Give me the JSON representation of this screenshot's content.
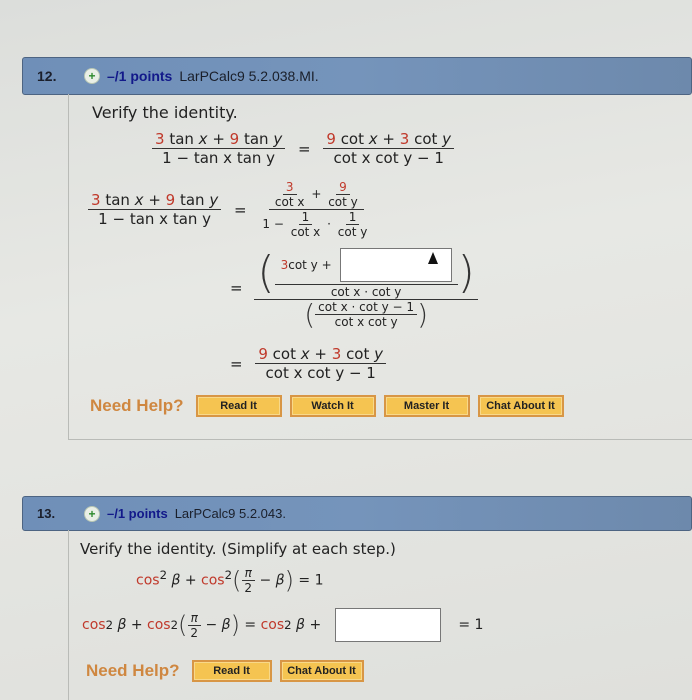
{
  "questions": [
    {
      "number": "12.",
      "points": "–/1 points",
      "code": "LarPCalc9 5.2.038.MI.",
      "prompt": "Verify the identity.",
      "identity": {
        "lhs_num": [
          "3",
          " tan ",
          "x",
          " + ",
          "9",
          " tan ",
          "y"
        ],
        "lhs_den": "1 − tan x tan y",
        "rhs_num": [
          "9",
          " cot ",
          "x",
          " + ",
          "3",
          " cot ",
          "y"
        ],
        "rhs_den": "cot x cot y − 1"
      },
      "step1": {
        "a_num": "3",
        "a_den": "cot x",
        "b_num": "9",
        "b_den": "cot y",
        "den_prefix": "1 −",
        "c_num": "1",
        "c_den": "cot x",
        "d_num": "1",
        "d_den": "cot y",
        "plus": "+",
        "dot": "·"
      },
      "step2": {
        "num_prefix_coef": "3",
        "num_prefix_text": " cot y +",
        "answer_value": "",
        "num_den": "cot x · cot y",
        "den_num": "cot x · cot y − 1",
        "den_den": "cot x cot y"
      },
      "help_label": "Need Help?",
      "help_buttons": [
        "Read It",
        "Watch It",
        "Master It",
        "Chat About It"
      ]
    },
    {
      "number": "13.",
      "points": "–/1 points",
      "code": "LarPCalc9 5.2.043.",
      "prompt": "Verify the identity. (Simplify at each step.)",
      "identity": {
        "t1": "cos",
        "sup": "2",
        "beta": "β",
        "plus": "+",
        "pi": "π",
        "two": "2",
        "minus": "−",
        "rhs": "= 1"
      },
      "step": {
        "rhs_prefix": "cos",
        "answer_value": "",
        "rhs": "= 1"
      },
      "help_label": "Need Help?",
      "help_buttons": [
        "Read It",
        "Chat About It"
      ]
    }
  ],
  "symbols": {
    "equals": "="
  },
  "colors": {
    "header": "#7594bb",
    "accent_red": "#c0392b",
    "help_orange": "#cf8740",
    "button_yellow": "#f5c451"
  }
}
